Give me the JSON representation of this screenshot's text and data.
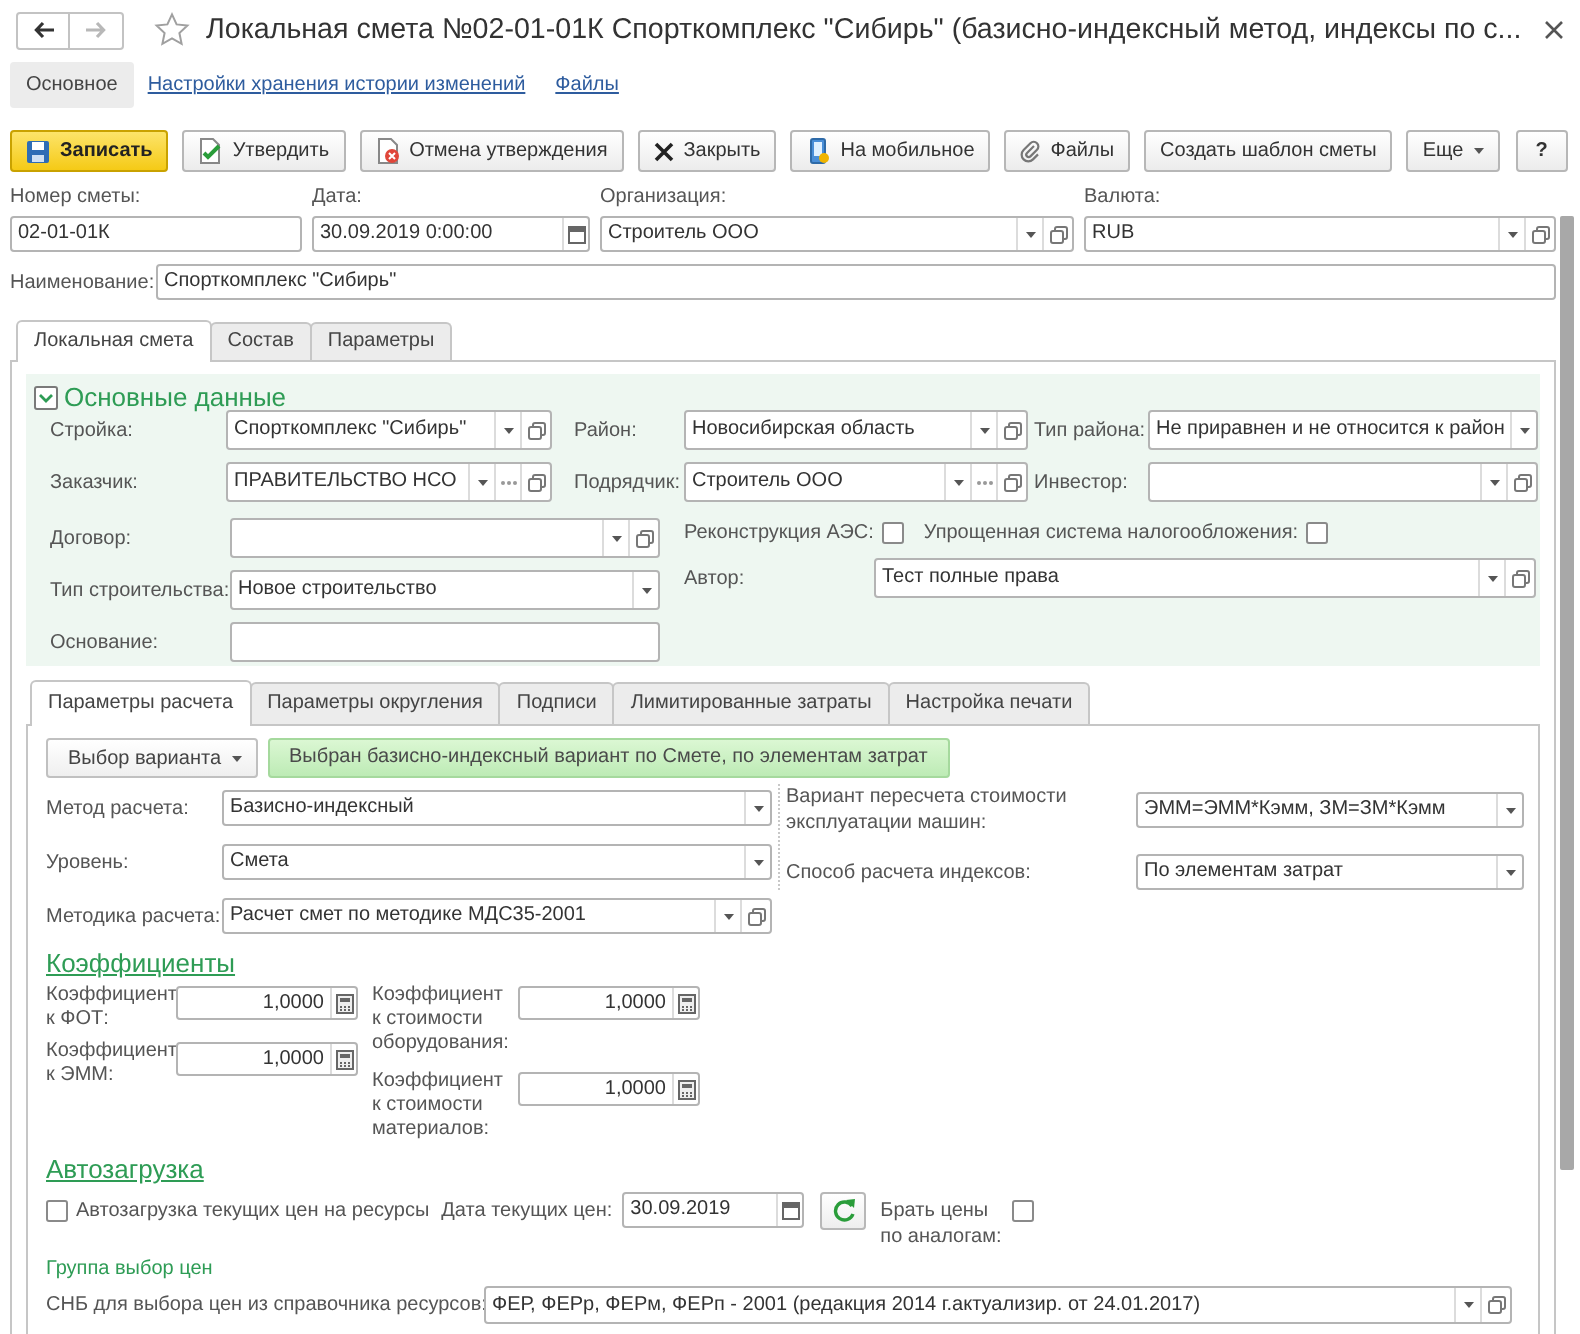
{
  "window": {
    "title": "Локальная смета №02-01-01К Спорткомплекс \"Сибирь\" (базисно-индексный метод, индексы по с...",
    "back": {
      "disabled": false
    },
    "forward": {
      "disabled": true
    },
    "favorite": false
  },
  "nav": [
    {
      "label": "Основное",
      "selected": true
    },
    {
      "label": "Настройки хранения истории изменений",
      "selected": false
    },
    {
      "label": "Файлы",
      "selected": false
    }
  ],
  "toolbar": [
    {
      "label": "Записать",
      "kind": "save"
    },
    {
      "label": "Утвердить",
      "kind": "approve"
    },
    {
      "label": "Отмена утверждения",
      "kind": "unapprove"
    },
    {
      "label": "Закрыть",
      "kind": "close"
    },
    {
      "label": "На мобильное",
      "kind": "mobile"
    },
    {
      "label": "Файлы",
      "kind": "files"
    },
    {
      "label": "Создать шаблон сметы",
      "kind": "create"
    },
    {
      "label": "Еще",
      "kind": "more"
    },
    {
      "label": "?",
      "kind": "help"
    }
  ],
  "header_fields": [
    {
      "label": "Номер сметы:",
      "value": "02-01-01К",
      "kind": "text"
    },
    {
      "label": "Дата:",
      "value": "30.09.2019 0:00:00",
      "kind": "date"
    },
    {
      "label": "Организация:",
      "value": "Строитель ООО",
      "kind": "ref"
    },
    {
      "label": "Валюта:",
      "value": "RUB",
      "kind": "ref"
    }
  ],
  "name_field": {
    "label": "Наименование:",
    "value": "Спорткомплекс \"Сибирь\"",
    "kind": "text"
  },
  "tabs": [
    {
      "label": "Локальная смета",
      "selected": true
    },
    {
      "label": "Состав",
      "selected": false
    },
    {
      "label": "Параметры",
      "selected": false
    }
  ],
  "main_data": {
    "title": "Основные данные",
    "expanded": true,
    "rows": [
      [
        {
          "label": "Стройка:",
          "value": "Спорткомплекс \"Сибирь\"",
          "kind": "ref"
        },
        {
          "label": "Район:",
          "value": "Новосибирская область",
          "kind": "ref"
        },
        {
          "label": "Тип района:",
          "value": "Не приравнен и не относится к район",
          "kind": "list"
        }
      ],
      [
        {
          "label": "Заказчик:",
          "value": "ПРАВИТЕЛЬСТВО НСО",
          "kind": "refchoice"
        },
        {
          "label": "Подрядчик:",
          "value": "Строитель ООО",
          "kind": "refchoice"
        },
        {
          "label": "Инвестор:",
          "kind": "ref"
        }
      ]
    ],
    "left_fields": [
      {
        "label": "Договор:",
        "kind": "ref"
      },
      {
        "label": "Тип строительства:",
        "value": "Новое строительство",
        "kind": "list"
      },
      {
        "label": "Основание:",
        "kind": "text"
      }
    ],
    "flags": [
      {
        "label": "Реконструкция АЭС:",
        "checked": false
      },
      {
        "label": "Упрощенная система налогообложения:",
        "checked": false
      }
    ],
    "author": {
      "label": "Автор:",
      "value": "Тест полные права",
      "kind": "ref"
    }
  },
  "calc_tabs": [
    {
      "label": "Параметры расчета",
      "selected": true
    },
    {
      "label": "Параметры округления",
      "selected": false
    },
    {
      "label": "Подписи",
      "selected": false
    },
    {
      "label": "Лимитированные затраты",
      "selected": false
    },
    {
      "label": "Настройка печати",
      "selected": false
    }
  ],
  "calc": {
    "variant_button": "Выбор варианта",
    "variant_status": "Выбран базисно-индексный вариант по Смете, по элементам затрат",
    "left_fields": [
      {
        "label": "Метод расчета:",
        "value": "Базисно-индексный",
        "kind": "list"
      },
      {
        "label": "Уровень:",
        "value": "Смета",
        "kind": "list"
      },
      {
        "label": "Методика расчета:",
        "value": "Расчет смет по методике МДС35-2001",
        "kind": "ref"
      }
    ],
    "right_fields": [
      {
        "label": "Вариант пересчета стоимости эксплуатации машин:",
        "value": "ЭММ=ЭММ*Кэмм, ЗМ=ЗМ*Кэмм",
        "kind": "list"
      },
      {
        "label": "Способ расчета индексов:",
        "value": "По элементам затрат",
        "kind": "list"
      }
    ],
    "coefficients": {
      "title": "Коэффициенты",
      "left": [
        {
          "label": "Коэффициент к ФОТ:",
          "value": "1,0000",
          "kind": "number"
        },
        {
          "label": "Коэффициент к ЭММ:",
          "value": "1,0000",
          "kind": "number"
        }
      ],
      "right": [
        {
          "label": "Коэффициент к стоимости оборудования:",
          "value": "1,0000",
          "kind": "number"
        },
        {
          "label": "Коэффициент к стоимости материалов:",
          "value": "1,0000",
          "kind": "number"
        }
      ]
    },
    "autoload": {
      "title": "Автозагрузка",
      "load_prices": {
        "label": "Автозагрузка текущих цен на ресурсы",
        "checked": false
      },
      "price_date": {
        "label": "Дата текущих цен:",
        "value": "30.09.2019",
        "kind": "date"
      },
      "analogs": {
        "label": "Брать цены по аналогам:",
        "checked": false
      }
    },
    "price_group": {
      "title": "Группа выбор цен",
      "field": {
        "label": "СНБ для выбора цен из справочника ресурсов:",
        "value": "ФЕР, ФЕРр, ФЕРм, ФЕРп - 2001 (редакция 2014 г.актуализир. от 24.01.2017)",
        "kind": "ref"
      }
    }
  }
}
